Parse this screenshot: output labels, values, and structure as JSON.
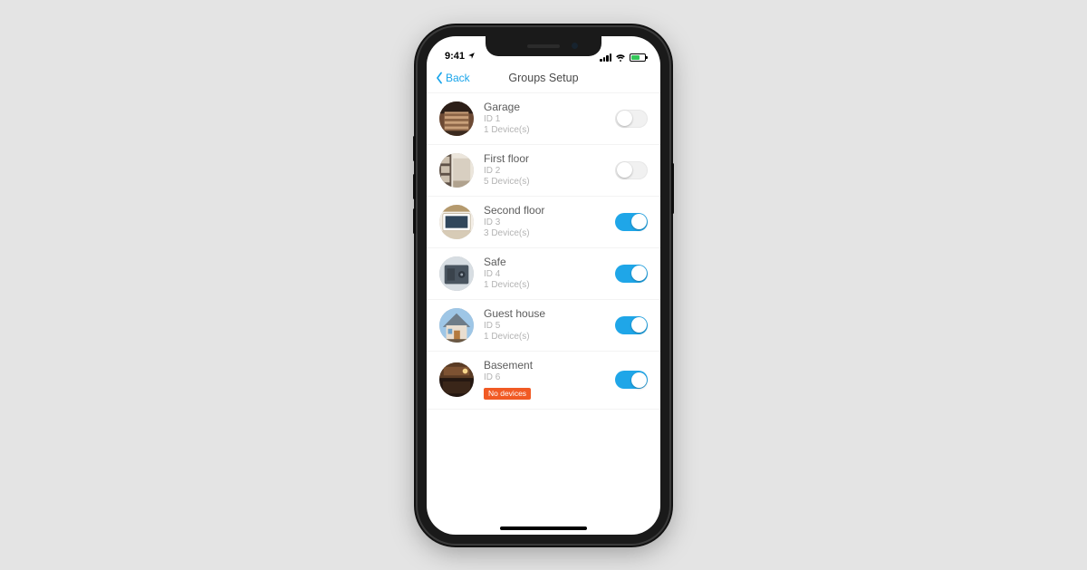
{
  "status": {
    "time": "9:41",
    "location_icon": "location-arrow"
  },
  "nav": {
    "back_label": "Back",
    "title": "Groups Setup"
  },
  "colors": {
    "accent": "#1fa6e8",
    "no_devices_badge": "#f15a24"
  },
  "no_devices_label": "No devices",
  "groups": [
    {
      "name": "Garage",
      "id_line": "ID 1",
      "devices_line": "1 Device(s)",
      "enabled": false,
      "thumb_key": "garage",
      "has_devices": true
    },
    {
      "name": "First floor",
      "id_line": "ID 2",
      "devices_line": "5 Device(s)",
      "enabled": false,
      "thumb_key": "first-floor",
      "has_devices": true
    },
    {
      "name": "Second floor",
      "id_line": "ID 3",
      "devices_line": "3 Device(s)",
      "enabled": true,
      "thumb_key": "second-floor",
      "has_devices": true
    },
    {
      "name": "Safe",
      "id_line": "ID 4",
      "devices_line": "1 Device(s)",
      "enabled": true,
      "thumb_key": "safe",
      "has_devices": true
    },
    {
      "name": "Guest house",
      "id_line": "ID 5",
      "devices_line": "1 Device(s)",
      "enabled": true,
      "thumb_key": "guest-house",
      "has_devices": true
    },
    {
      "name": "Basement",
      "id_line": "ID 6",
      "devices_line": "",
      "enabled": true,
      "thumb_key": "basement",
      "has_devices": false
    }
  ]
}
